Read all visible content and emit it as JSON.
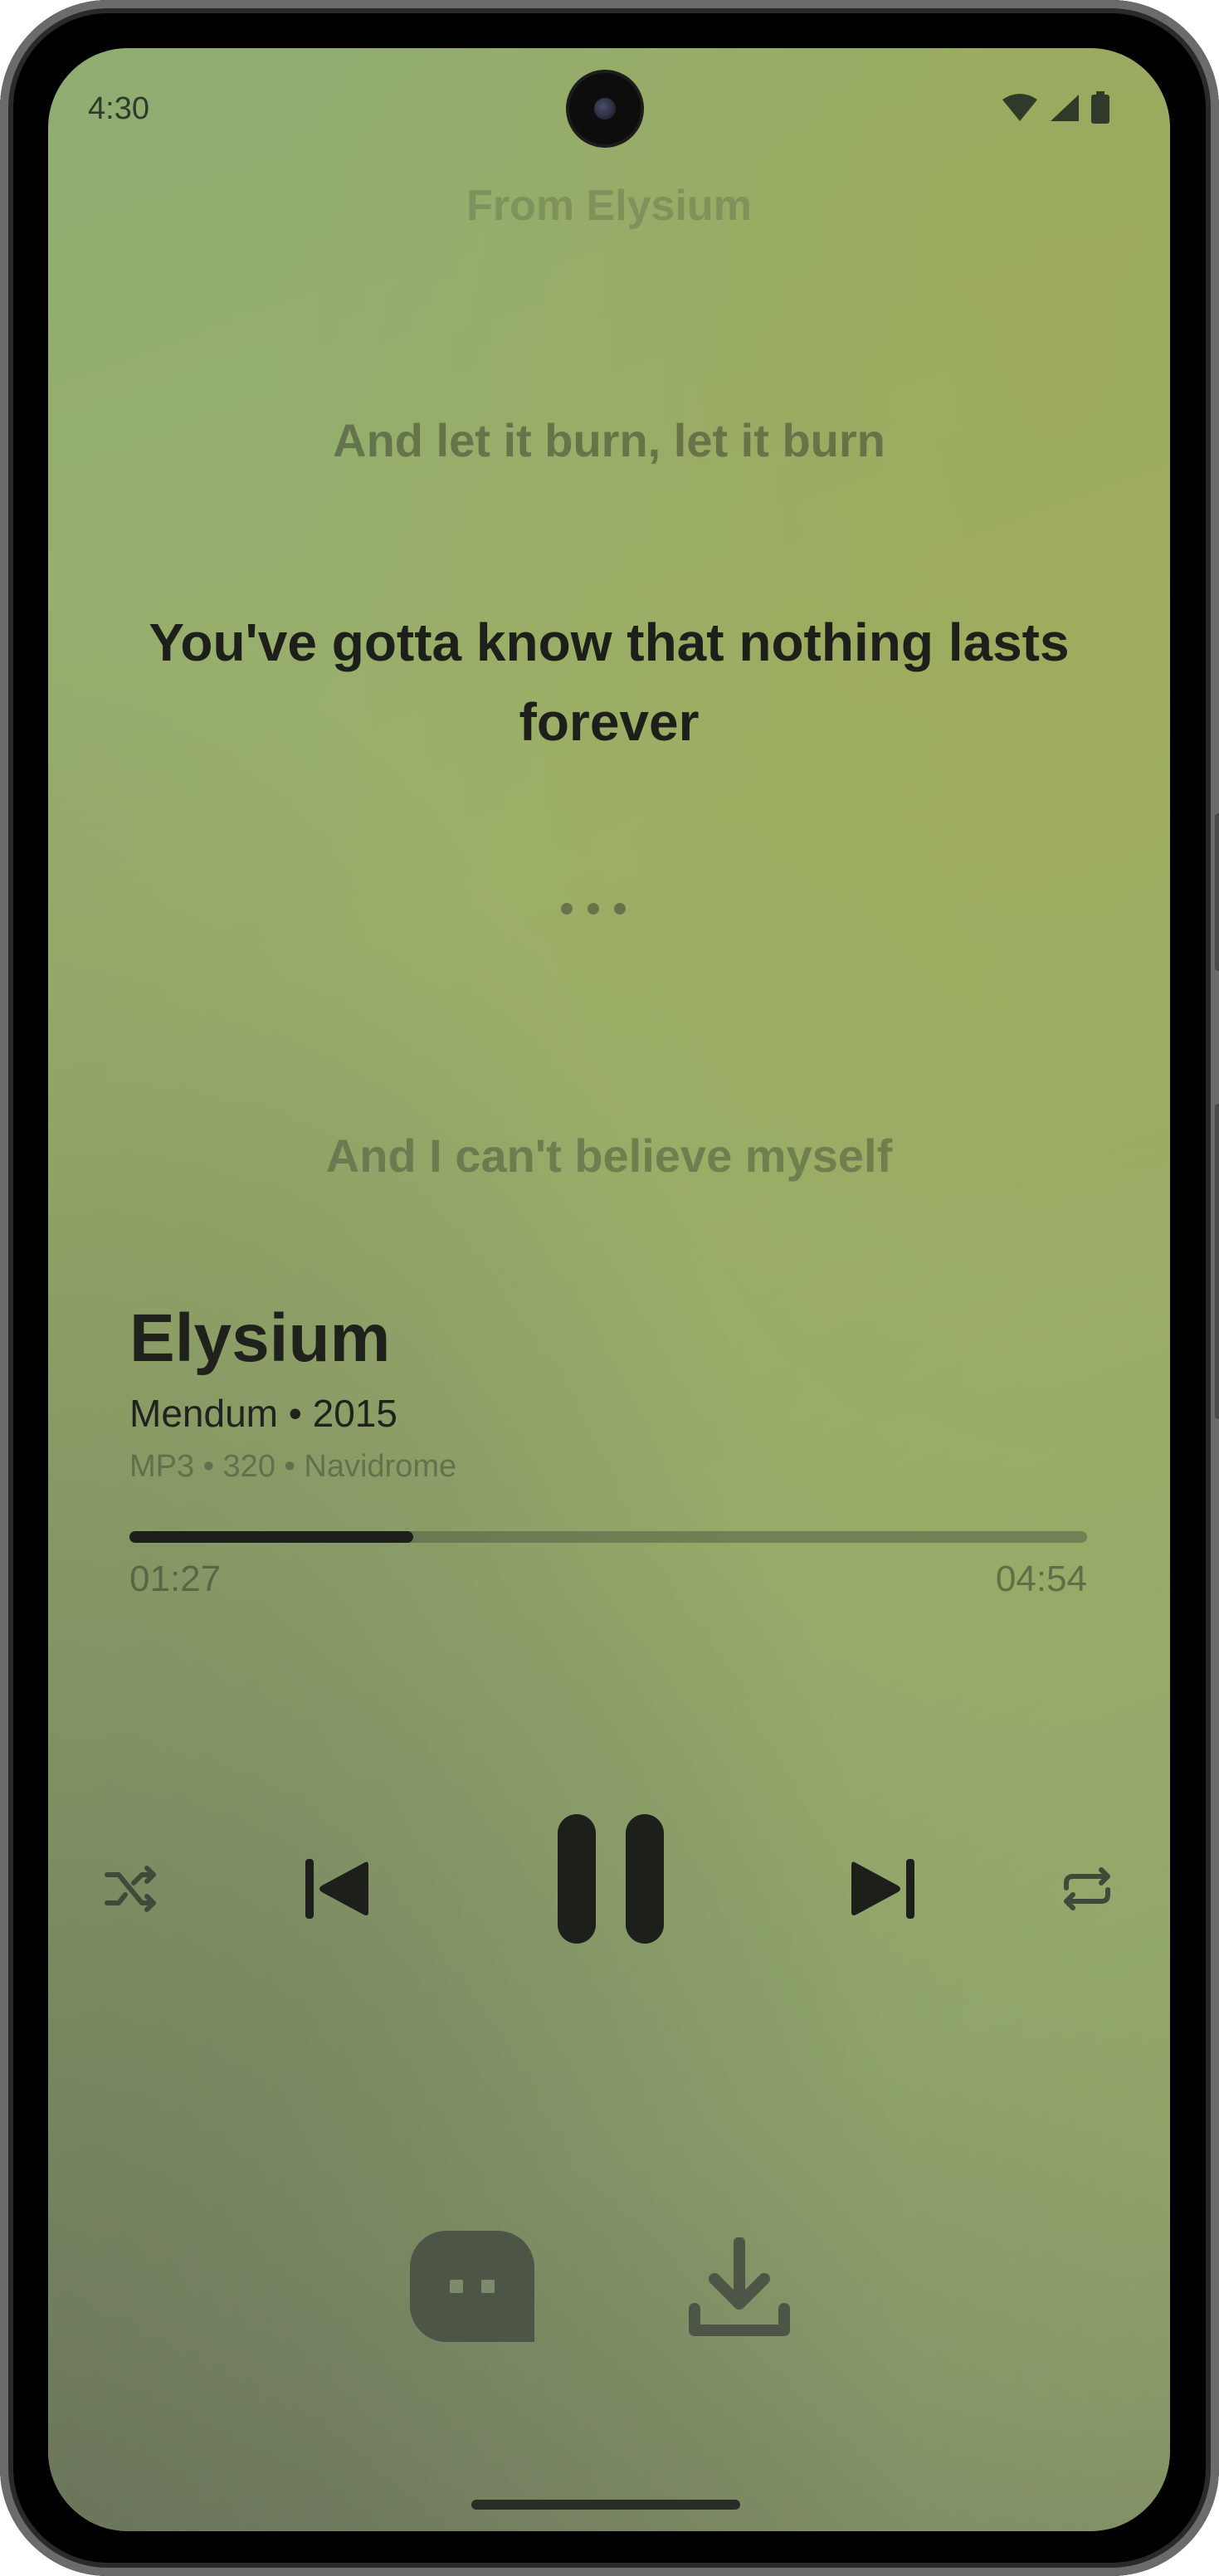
{
  "status_bar": {
    "time": "4:30",
    "icons": [
      "wifi-icon",
      "cell-signal-icon",
      "battery-icon"
    ]
  },
  "lyrics": {
    "faded_top": "From Elysium",
    "previous": "And let it burn, let it burn",
    "current": "You've gotta know that nothing lasts forever",
    "instrumental_indicator": "• • •",
    "next": "And I can't believe myself"
  },
  "track": {
    "title": "Elysium",
    "meta": "Mendum • 2015",
    "format": "MP3 • 320 • Navidrome"
  },
  "progress": {
    "elapsed": "01:27",
    "total": "04:54",
    "fraction": 0.296
  },
  "controls": {
    "shuffle": "shuffle-icon",
    "previous": "skip-previous-icon",
    "play_pause": "pause-icon",
    "next": "skip-next-icon",
    "repeat": "repeat-icon"
  },
  "bottom_actions": {
    "lyrics": "lyrics-icon",
    "download": "download-icon"
  },
  "colors": {
    "accent_dark": "#1d1f1b",
    "background": "#93a86c",
    "button_bg": "#4d5546"
  }
}
